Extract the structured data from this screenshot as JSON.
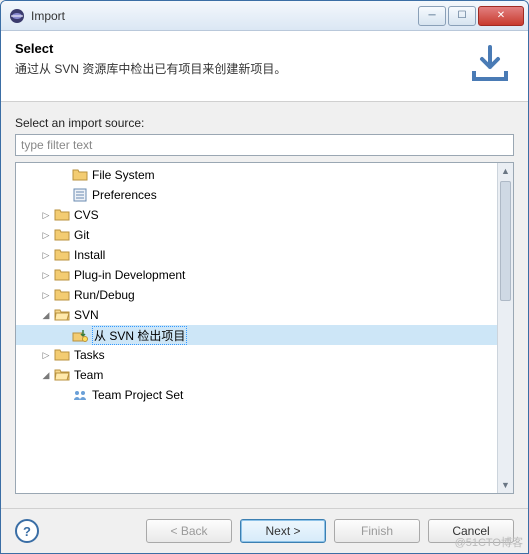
{
  "titlebar": {
    "title": "Import"
  },
  "banner": {
    "title": "Select",
    "description": "通过从 SVN 资源库中检出已有项目来创建新项目。"
  },
  "content": {
    "label": "Select an import source:",
    "filterPlaceholder": "type filter text"
  },
  "tree": [
    {
      "depth": 1,
      "twisty": "none",
      "icon": "folder-plain",
      "label": "File System"
    },
    {
      "depth": 1,
      "twisty": "none",
      "icon": "pref",
      "label": "Preferences"
    },
    {
      "depth": 0,
      "twisty": "closed",
      "icon": "folder",
      "label": "CVS"
    },
    {
      "depth": 0,
      "twisty": "closed",
      "icon": "folder",
      "label": "Git"
    },
    {
      "depth": 0,
      "twisty": "closed",
      "icon": "folder",
      "label": "Install"
    },
    {
      "depth": 0,
      "twisty": "closed",
      "icon": "folder",
      "label": "Plug-in Development"
    },
    {
      "depth": 0,
      "twisty": "closed",
      "icon": "folder",
      "label": "Run/Debug"
    },
    {
      "depth": 0,
      "twisty": "open",
      "icon": "folder-open",
      "label": "SVN"
    },
    {
      "depth": 1,
      "twisty": "none",
      "icon": "svn-checkout",
      "label": "从 SVN 检出项目",
      "selected": true
    },
    {
      "depth": 0,
      "twisty": "closed",
      "icon": "folder",
      "label": "Tasks"
    },
    {
      "depth": 0,
      "twisty": "open",
      "icon": "folder-open",
      "label": "Team"
    },
    {
      "depth": 1,
      "twisty": "none",
      "icon": "team-set",
      "label": "Team Project Set"
    }
  ],
  "buttons": {
    "back": "< Back",
    "next": "Next >",
    "finish": "Finish",
    "cancel": "Cancel"
  },
  "watermark": "@51CTO博客"
}
